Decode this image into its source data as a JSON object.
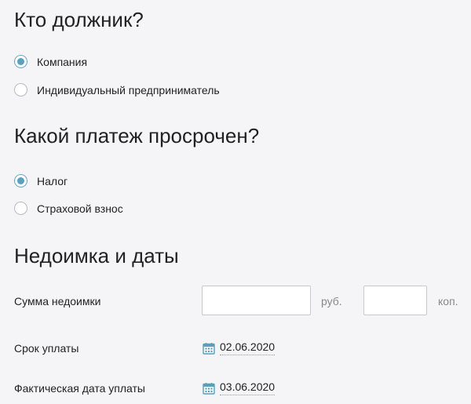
{
  "debtor": {
    "title": "Кто должник?",
    "options": [
      {
        "label": "Компания",
        "checked": true
      },
      {
        "label": "Индивидуальный предприниматель",
        "checked": false
      }
    ]
  },
  "payment": {
    "title": "Какой платеж просрочен?",
    "options": [
      {
        "label": "Налог",
        "checked": true
      },
      {
        "label": "Страховой взнос",
        "checked": false
      }
    ]
  },
  "arrears": {
    "title": "Недоимка и даты",
    "amount_label": "Сумма недоимки",
    "rub_value": "",
    "rub_unit": "руб.",
    "kop_value": "",
    "kop_unit": "коп.",
    "due_date_label": "Срок уплаты",
    "due_date": "02.06.2020",
    "actual_date_label": "Фактическая дата уплаты",
    "actual_date": "03.06.2020"
  },
  "colors": {
    "accent": "#5b9fc1",
    "background": "#f5f5f7",
    "calendar_icon": "#5aa0b8"
  },
  "icons": {
    "calendar": "calendar-icon"
  }
}
